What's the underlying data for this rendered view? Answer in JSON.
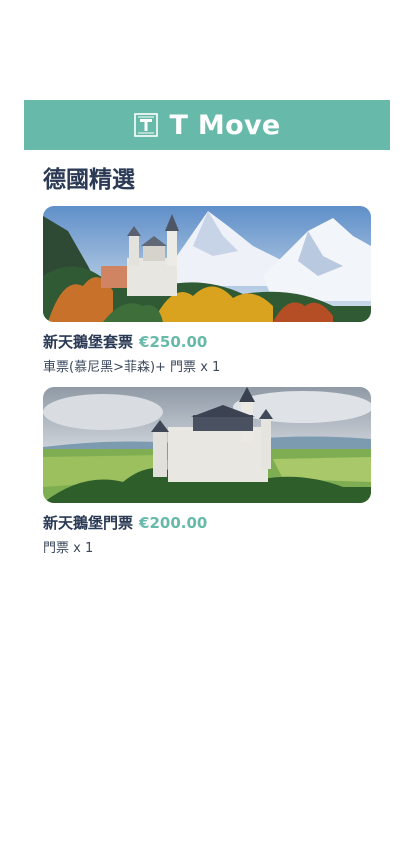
{
  "header": {
    "title": "T Move",
    "logo_icon": "t-logo-icon",
    "background": "#67b9a9"
  },
  "section": {
    "title": "德國精選"
  },
  "products": [
    {
      "name": "新天鵝堡套票",
      "price": "€250.00",
      "description": "車票(慕尼黑>菲森)+ 門票 x 1",
      "image": "neuschwanstein-autumn-mountains-image"
    },
    {
      "name": "新天鵝堡門票",
      "price": "€200.00",
      "description": "門票 x 1",
      "image": "neuschwanstein-summer-valley-image"
    }
  ],
  "colors": {
    "accent": "#67b9a9",
    "text_dark": "#2b3a55"
  }
}
